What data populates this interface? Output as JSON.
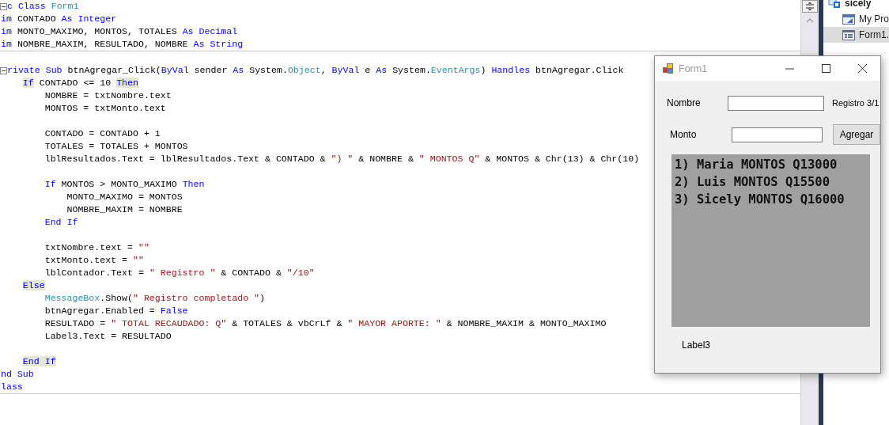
{
  "editor": {
    "lines": [
      {
        "fold": true,
        "tokens": [
          {
            "kind": "kw",
            "t": "c Class "
          },
          {
            "kind": "type",
            "t": "Form1"
          }
        ]
      },
      {
        "tokens": [
          {
            "kind": "kw",
            "t": "im"
          },
          {
            "kind": "plain",
            "t": " CONTADO "
          },
          {
            "kind": "kw",
            "t": "As Integer"
          }
        ]
      },
      {
        "tokens": [
          {
            "kind": "kw",
            "t": "im"
          },
          {
            "kind": "plain",
            "t": " MONTO_MAXIMO, MONTOS, TOTALES "
          },
          {
            "kind": "kw",
            "t": "As Decimal"
          }
        ]
      },
      {
        "divider": true,
        "tokens": [
          {
            "kind": "kw",
            "t": "im"
          },
          {
            "kind": "plain",
            "t": " NOMBRE_MAXIM, RESULTADO, NOMBRE "
          },
          {
            "kind": "kw",
            "t": "As String"
          }
        ]
      },
      {
        "fold": true,
        "gap_before": true,
        "tokens": [
          {
            "kind": "kw",
            "t": "rivate Sub"
          },
          {
            "kind": "plain",
            "t": " btnAgregar_Click("
          },
          {
            "kind": "kw",
            "t": "ByVal"
          },
          {
            "kind": "plain",
            "t": " sender "
          },
          {
            "kind": "kw",
            "t": "As"
          },
          {
            "kind": "plain",
            "t": " System."
          },
          {
            "kind": "type",
            "t": "Object"
          },
          {
            "kind": "plain",
            "t": ", "
          },
          {
            "kind": "kw",
            "t": "ByVal"
          },
          {
            "kind": "plain",
            "t": " e "
          },
          {
            "kind": "kw",
            "t": "As"
          },
          {
            "kind": "plain",
            "t": " System."
          },
          {
            "kind": "type",
            "t": "EventArgs"
          },
          {
            "kind": "plain",
            "t": ") "
          },
          {
            "kind": "kw",
            "t": "Handles"
          },
          {
            "kind": "plain",
            "t": " btnAgregar.Click"
          }
        ]
      },
      {
        "tokens": [
          {
            "kind": "hl",
            "t": "    If"
          },
          {
            "kind": "plain",
            "t": " CONTADO <= 10 "
          },
          {
            "kind": "hl",
            "t": "Then"
          }
        ]
      },
      {
        "tokens": [
          {
            "kind": "plain",
            "t": "        NOMBRE = txtNombre.text"
          }
        ]
      },
      {
        "tokens": [
          {
            "kind": "plain",
            "t": "        MONTOS = txtMonto.text"
          }
        ]
      },
      {
        "gap_before": true,
        "tokens": [
          {
            "kind": "plain",
            "t": "        CONTADO = CONTADO + 1"
          }
        ]
      },
      {
        "tokens": [
          {
            "kind": "plain",
            "t": "        TOTALES = TOTALES + MONTOS"
          }
        ]
      },
      {
        "tokens": [
          {
            "kind": "plain",
            "t": "        lblResultados.Text = lblResultados.Text & CONTADO & "
          },
          {
            "kind": "str",
            "t": "\") \""
          },
          {
            "kind": "plain",
            "t": " & NOMBRE & "
          },
          {
            "kind": "str",
            "t": "\" MONTOS Q\""
          },
          {
            "kind": "plain",
            "t": " & MONTOS & Chr(13) & Chr(10)"
          }
        ]
      },
      {
        "gap_before": true,
        "tokens": [
          {
            "kind": "kw",
            "t": "        If"
          },
          {
            "kind": "plain",
            "t": " MONTOS > MONTO_MAXIMO "
          },
          {
            "kind": "kw",
            "t": "Then"
          }
        ]
      },
      {
        "tokens": [
          {
            "kind": "plain",
            "t": "            MONTO_MAXIMO = MONTOS"
          }
        ]
      },
      {
        "tokens": [
          {
            "kind": "plain",
            "t": "            NOMBRE_MAXIM = NOMBRE"
          }
        ]
      },
      {
        "tokens": [
          {
            "kind": "kw",
            "t": "        End If"
          }
        ]
      },
      {
        "gap_before": true,
        "tokens": [
          {
            "kind": "plain",
            "t": "        txtNombre.text = "
          },
          {
            "kind": "str",
            "t": "\"\""
          }
        ]
      },
      {
        "tokens": [
          {
            "kind": "plain",
            "t": "        txtMonto.text = "
          },
          {
            "kind": "str",
            "t": "\"\""
          }
        ]
      },
      {
        "tokens": [
          {
            "kind": "plain",
            "t": "        lblContador.Text = "
          },
          {
            "kind": "str",
            "t": "\" Registro \""
          },
          {
            "kind": "plain",
            "t": " & CONTADO & "
          },
          {
            "kind": "str",
            "t": "\"/10\""
          }
        ]
      },
      {
        "tokens": [
          {
            "kind": "hl",
            "t": "    Else"
          }
        ]
      },
      {
        "tokens": [
          {
            "kind": "type",
            "t": "        MessageBox"
          },
          {
            "kind": "plain",
            "t": ".Show("
          },
          {
            "kind": "str",
            "t": "\" Registro completado \""
          },
          {
            "kind": "plain",
            "t": ")"
          }
        ]
      },
      {
        "tokens": [
          {
            "kind": "plain",
            "t": "        btnAgregar.Enabled = "
          },
          {
            "kind": "kw",
            "t": "False"
          }
        ]
      },
      {
        "tokens": [
          {
            "kind": "plain",
            "t": "        RESULTADO = "
          },
          {
            "kind": "str",
            "t": "\" TOTAL RECAUDADO: Q\""
          },
          {
            "kind": "plain",
            "t": " & TOTALES & vbCrLf & "
          },
          {
            "kind": "str",
            "t": "\" MAYOR APORTE: \""
          },
          {
            "kind": "plain",
            "t": " & NOMBRE_MAXIM & MONTO_MAXIMO"
          }
        ]
      },
      {
        "tokens": [
          {
            "kind": "plain",
            "t": "        Label3.Text = RESULTADO"
          }
        ]
      },
      {
        "gap_before": true,
        "tokens": [
          {
            "kind": "hl",
            "t": "    End If"
          }
        ]
      },
      {
        "tokens": [
          {
            "kind": "kw",
            "t": "nd Sub"
          }
        ]
      },
      {
        "divider": true,
        "tokens": [
          {
            "kind": "kw",
            "t": "lass"
          }
        ]
      }
    ]
  },
  "solution_explorer": {
    "items": [
      {
        "label": "sicely",
        "kind": "solution",
        "selected": false,
        "children": [
          {
            "label": "My Pro",
            "kind": "project",
            "selected": false
          },
          {
            "label": "Form1.",
            "kind": "form",
            "selected": true
          }
        ]
      }
    ]
  },
  "form_window": {
    "title": "Form1",
    "fields": [
      {
        "label": "Nombre"
      },
      {
        "label": "Monto"
      }
    ],
    "counter": "Registro 3/1",
    "button": "Agregar",
    "results": [
      "1) Maria MONTOS Q13000",
      "2) Luis MONTOS Q15500",
      "3) Sicely MONTOS Q16000"
    ],
    "footer_label": "Label3"
  }
}
